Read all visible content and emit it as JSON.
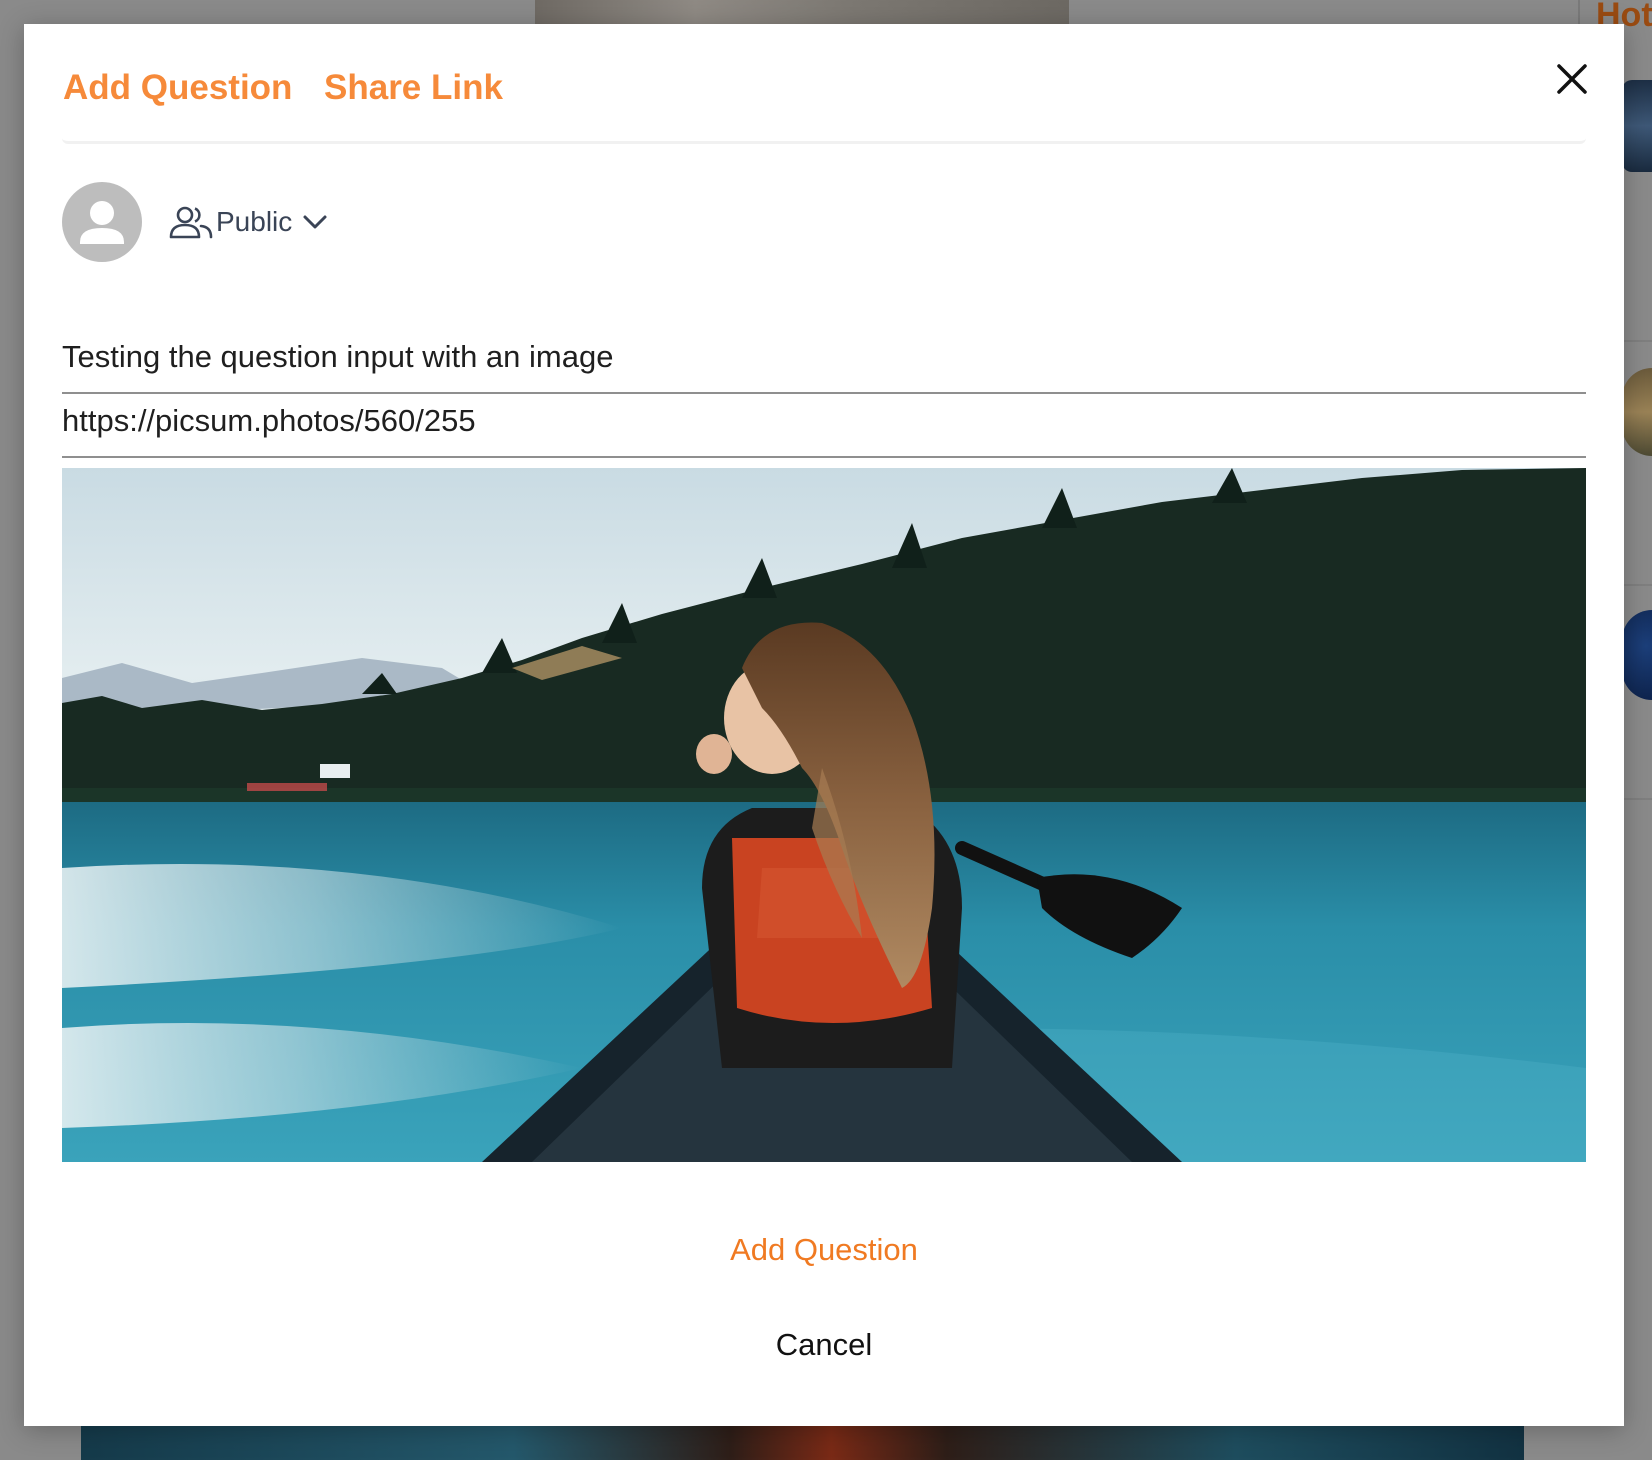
{
  "background": {
    "sidebar_title": "Hot"
  },
  "modal": {
    "tabs": [
      {
        "label": "Add Question"
      },
      {
        "label": "Share Link"
      }
    ],
    "privacy": {
      "selected": "Public"
    },
    "question_input": {
      "value": "Testing the question input with an image"
    },
    "image_url_input": {
      "value": "https://picsum.photos/560/255"
    },
    "preview_image": {
      "description": "Person in canoe on turquoise lake with forest"
    },
    "submit_label": "Add Question",
    "cancel_label": "Cancel"
  },
  "colors": {
    "accent": "#f68a3a",
    "submit_text": "#f07a22",
    "overlay": "#8a8a8a",
    "avatar_bg": "#bdbdbd"
  }
}
